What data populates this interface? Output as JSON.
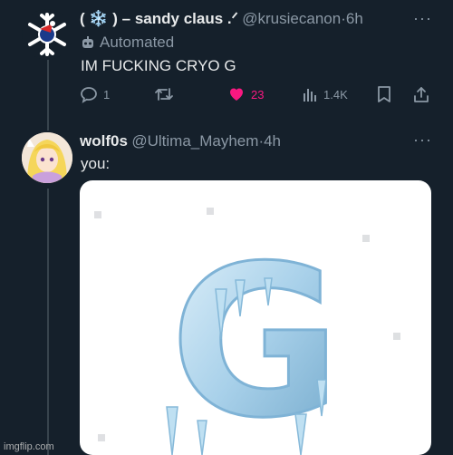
{
  "tweet1": {
    "display_name": "( ❄️ ) – sandy claus .ᐟ",
    "handle": "@krusiecanon",
    "time": "·6h",
    "label": "Automated",
    "text": "IM FUCKING CRYO G",
    "stats": {
      "replies": "1",
      "likes": "23",
      "views": "1.4K"
    }
  },
  "tweet2": {
    "display_name": "wolf0s",
    "handle": "@Ultima_Mayhem",
    "time": "·4h",
    "text": "you:",
    "media_letter": "G"
  },
  "footer": {
    "watermark": "imgflip.com"
  },
  "colors": {
    "background": "#15202b",
    "like": "#f91880",
    "muted": "#8b98a5",
    "ice": "#b7d9ee"
  }
}
